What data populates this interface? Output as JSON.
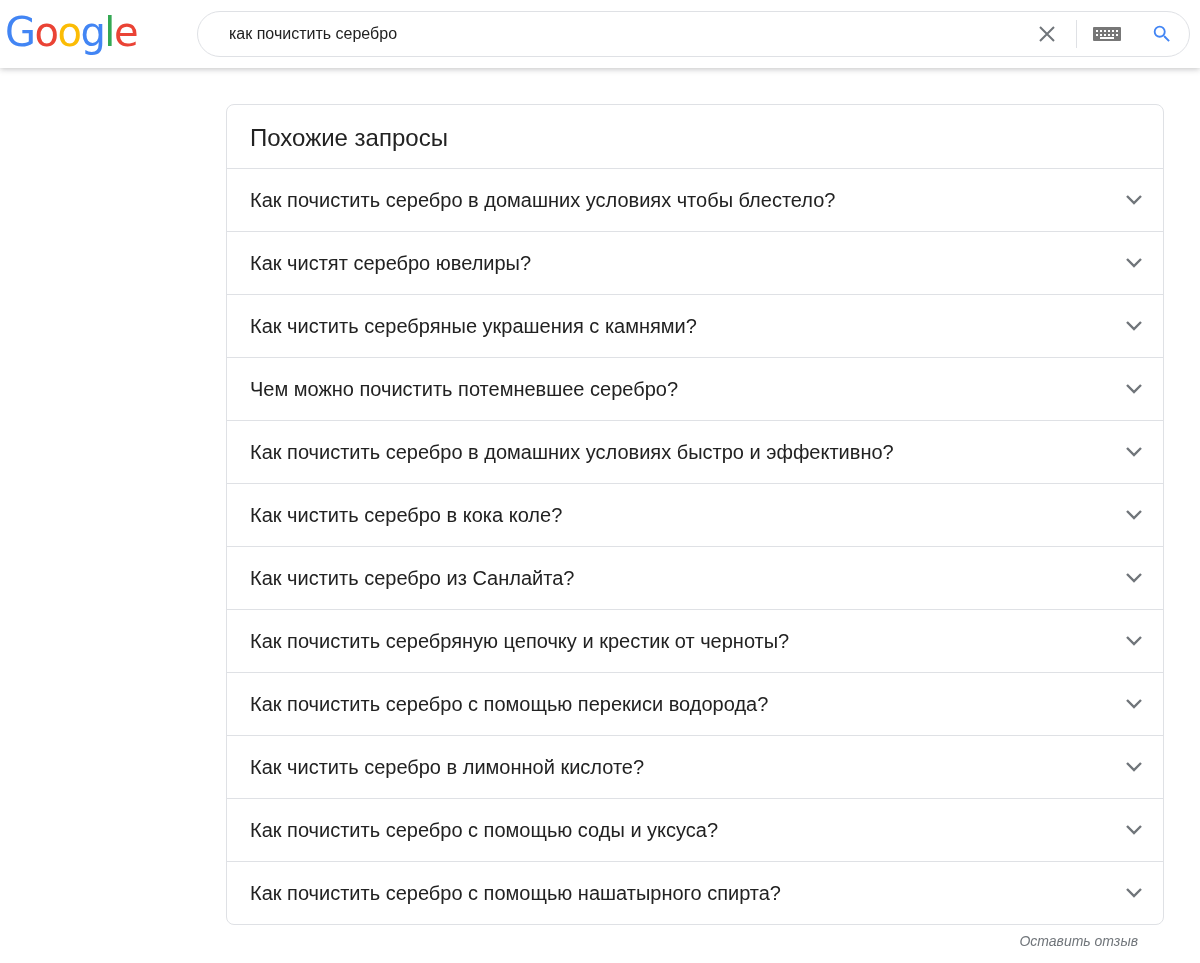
{
  "header": {
    "logo": "Google",
    "search": {
      "value": "как почистить серебро"
    }
  },
  "related": {
    "title": "Похожие запросы",
    "items": [
      {
        "text": "Как почистить серебро в домашних условиях чтобы блестело?",
        "expanded": false
      },
      {
        "text": "Как чистят серебро ювелиры?",
        "expanded": false
      },
      {
        "text": "Как чистить серебряные украшения с камнями?",
        "expanded": false
      },
      {
        "text": "Чем можно почистить потемневшее серебро?",
        "expanded": false
      },
      {
        "text": "Как почистить серебро в домашних условиях быстро и эффективно?",
        "expanded": false
      },
      {
        "text": "Как чистить серебро в кока коле?",
        "expanded": false
      },
      {
        "text": "Как чистить серебро из Санлайта?",
        "expanded": false
      },
      {
        "text": "Как почистить серебряную цепочку и крестик от черноты?",
        "expanded": false
      },
      {
        "text": "Как почистить серебро с помощью перекиси водорода?",
        "expanded": false
      },
      {
        "text": "Как чистить серебро в лимонной кислоте?",
        "expanded": false
      },
      {
        "text": "Как почистить серебро с помощью соды и уксуса?",
        "expanded": false
      },
      {
        "text": "Как почистить серебро с помощью нашатырного спирта?",
        "expanded": false
      }
    ]
  },
  "feedback": "Оставить отзыв"
}
